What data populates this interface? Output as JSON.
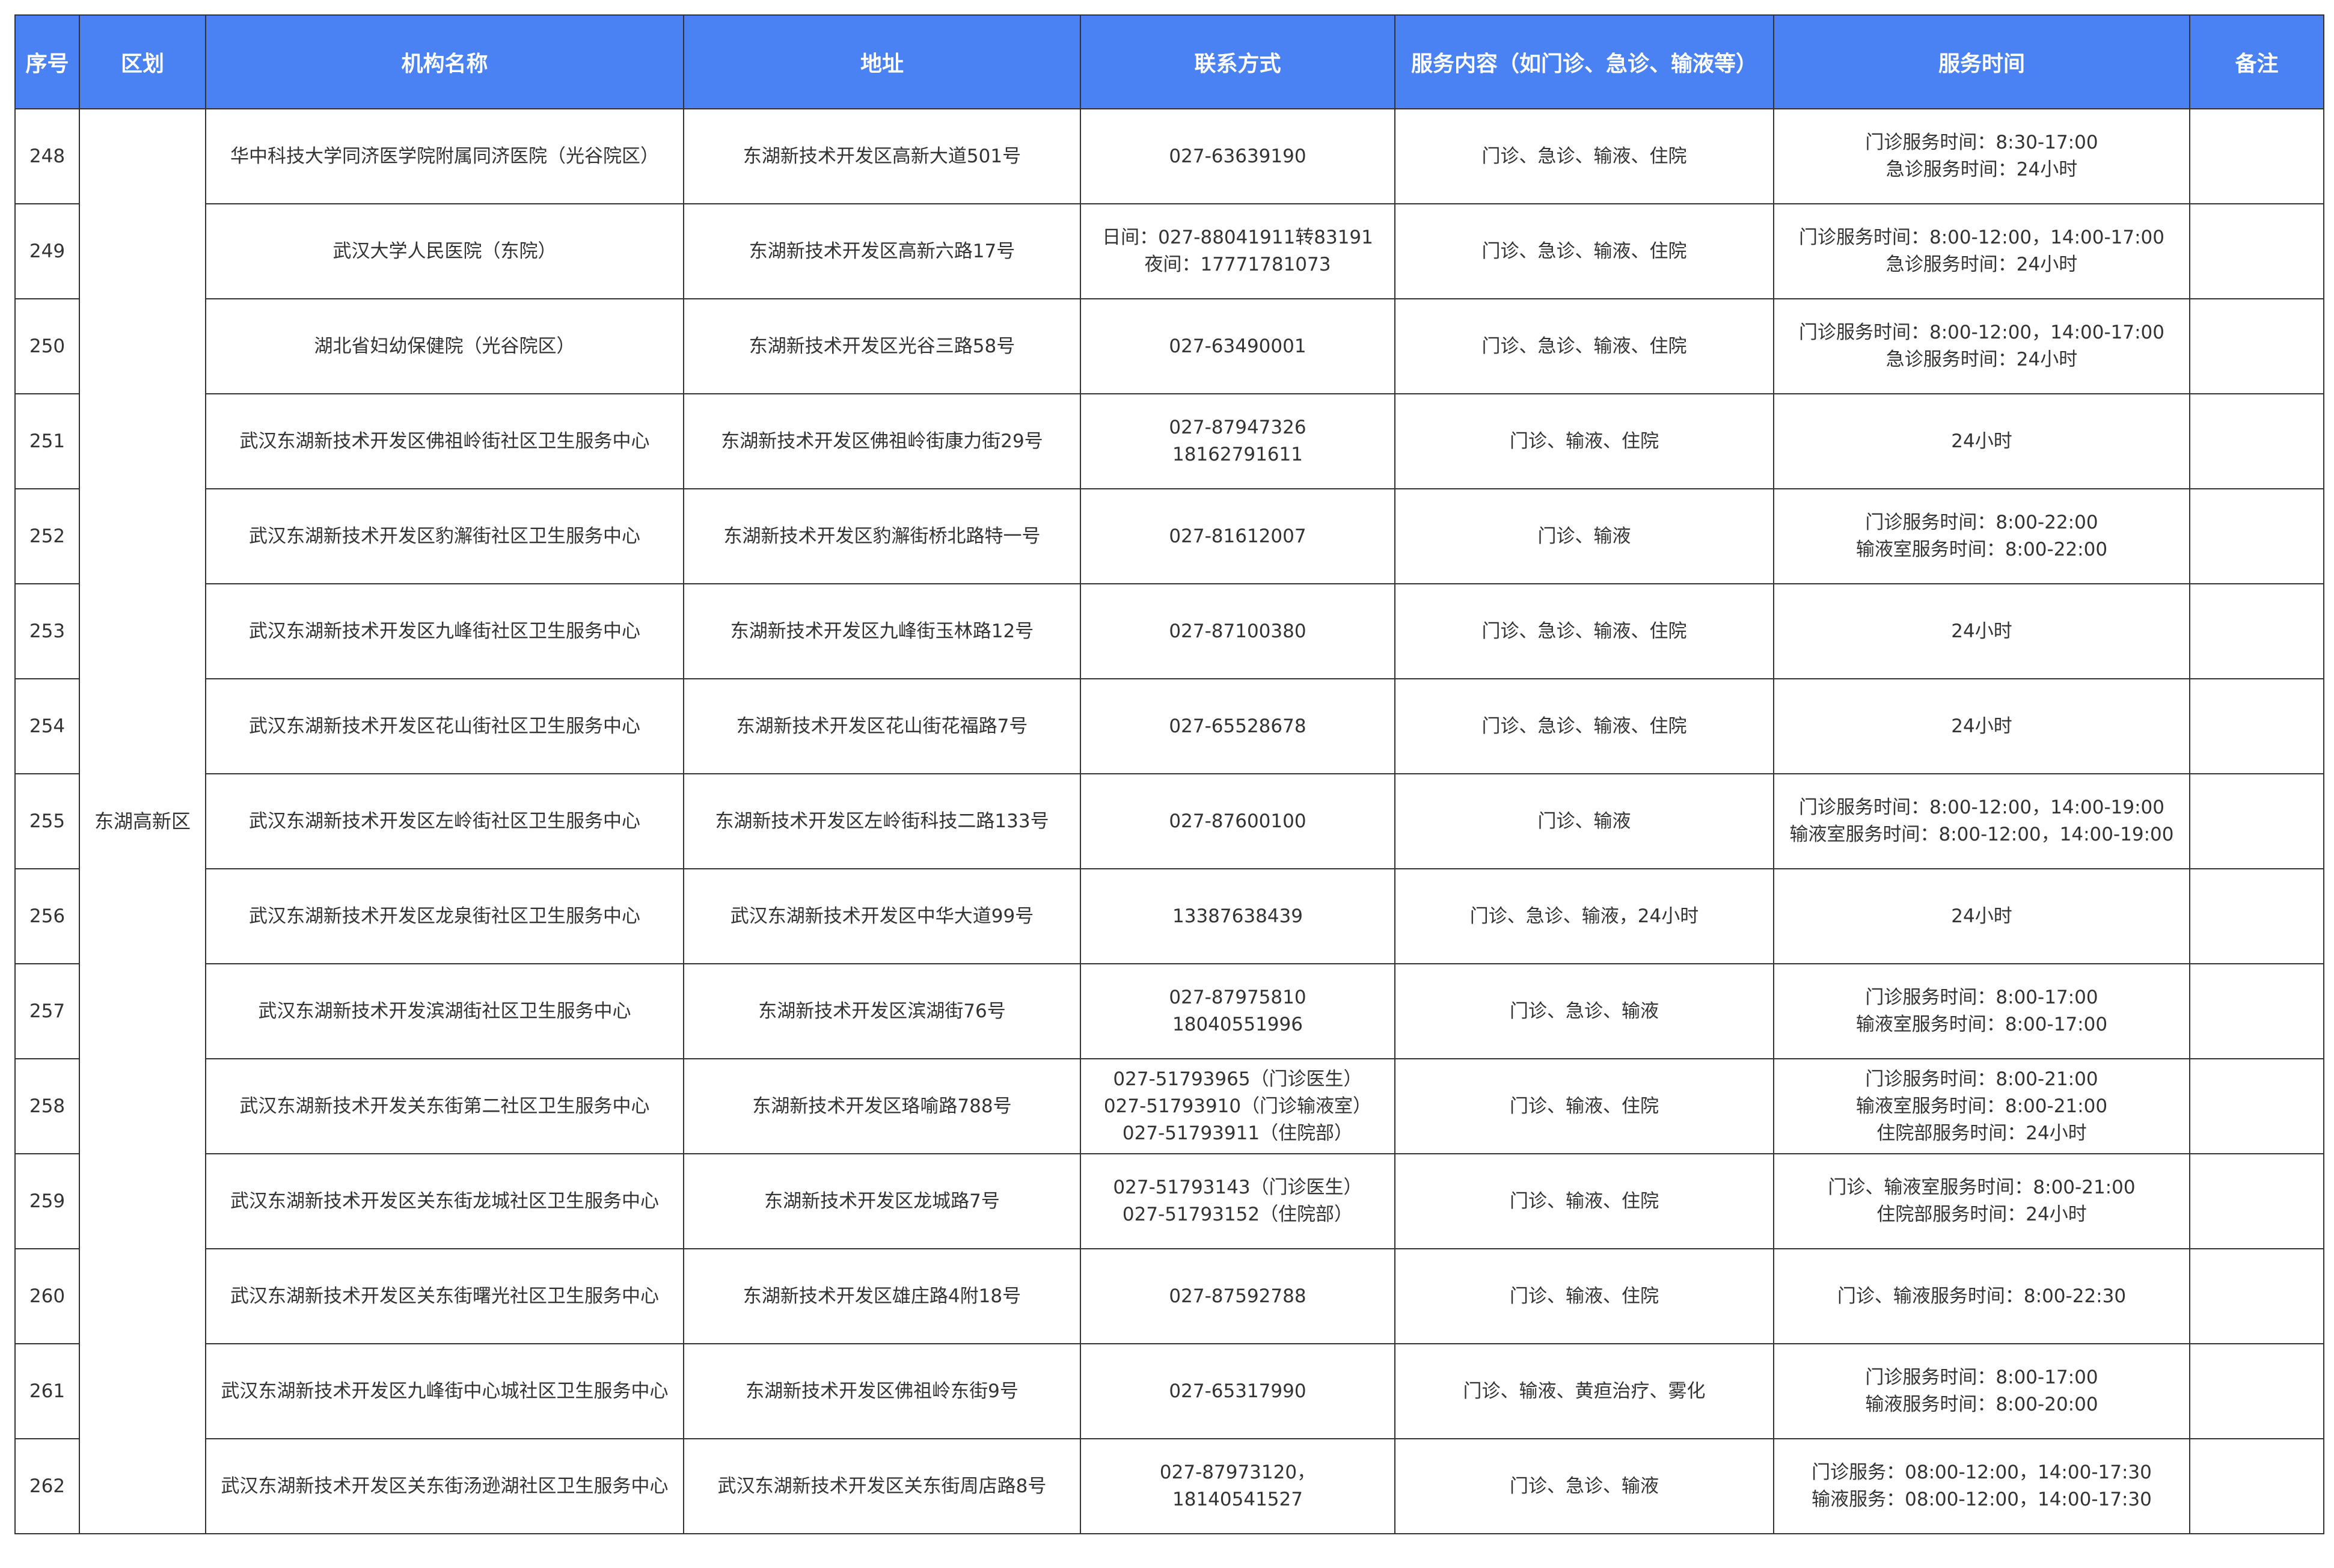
{
  "header": {
    "col_no": "序号",
    "col_district": "区划",
    "col_name": "机构名称",
    "col_address": "地址",
    "col_contact": "联系方式",
    "col_service": "服务内容（如门诊、急诊、输液等）",
    "col_time": "服务时间",
    "col_note": "备注"
  },
  "district": "东湖高新区",
  "rows": [
    {
      "no": "248",
      "name": "华中科技大学同济医学院附属同济医院（光谷院区）",
      "address": "东湖新技术开发区高新大道501号",
      "contact": [
        "027-63639190"
      ],
      "service": "门诊、急诊、输液、住院",
      "time": [
        "门诊服务时间：8:30-17:00",
        "急诊服务时间：24小时"
      ],
      "note": ""
    },
    {
      "no": "249",
      "name": "武汉大学人民医院（东院）",
      "address": "东湖新技术开发区高新六路17号",
      "contact": [
        "日间：027-88041911转83191",
        "夜间：17771781073"
      ],
      "service": "门诊、急诊、输液、住院",
      "time": [
        "门诊服务时间：8:00-12:00，14:00-17:00",
        "急诊服务时间：24小时"
      ],
      "note": ""
    },
    {
      "no": "250",
      "name": "湖北省妇幼保健院（光谷院区）",
      "address": "东湖新技术开发区光谷三路58号",
      "contact": [
        "027-63490001"
      ],
      "service": "门诊、急诊、输液、住院",
      "time": [
        "门诊服务时间：8:00-12:00，14:00-17:00",
        "急诊服务时间：24小时"
      ],
      "note": ""
    },
    {
      "no": "251",
      "name": "武汉东湖新技术开发区佛祖岭街社区卫生服务中心",
      "address": "东湖新技术开发区佛祖岭街康力街29号",
      "contact": [
        "027-87947326",
        "18162791611"
      ],
      "service": "门诊、输液、住院",
      "time": [
        "24小时"
      ],
      "note": ""
    },
    {
      "no": "252",
      "name": "武汉东湖新技术开发区豹澥街社区卫生服务中心",
      "address": "东湖新技术开发区豹澥街桥北路特一号",
      "contact": [
        "027-81612007"
      ],
      "service": "门诊、输液",
      "time": [
        "门诊服务时间：8:00-22:00",
        "输液室服务时间：8:00-22:00"
      ],
      "note": ""
    },
    {
      "no": "253",
      "name": "武汉东湖新技术开发区九峰街社区卫生服务中心",
      "address": "东湖新技术开发区九峰街玉林路12号",
      "contact": [
        "027-87100380"
      ],
      "service": "门诊、急诊、输液、住院",
      "time": [
        "24小时"
      ],
      "note": ""
    },
    {
      "no": "254",
      "name": "武汉东湖新技术开发区花山街社区卫生服务中心",
      "address": "东湖新技术开发区花山街花福路7号",
      "contact": [
        "027-65528678"
      ],
      "service": "门诊、急诊、输液、住院",
      "time": [
        "24小时"
      ],
      "note": ""
    },
    {
      "no": "255",
      "name": "武汉东湖新技术开发区左岭街社区卫生服务中心",
      "address": "东湖新技术开发区左岭街科技二路133号",
      "contact": [
        "027-87600100"
      ],
      "service": "门诊、输液",
      "time": [
        "门诊服务时间：8:00-12:00，14:00-19:00",
        "输液室服务时间：8:00-12:00，14:00-19:00"
      ],
      "note": ""
    },
    {
      "no": "256",
      "name": "武汉东湖新技术开发区龙泉街社区卫生服务中心",
      "address": "武汉东湖新技术开发区中华大道99号",
      "contact": [
        "13387638439"
      ],
      "service": "门诊、急诊、输液，24小时",
      "time": [
        "24小时"
      ],
      "note": ""
    },
    {
      "no": "257",
      "name": "武汉东湖新技术开发滨湖街社区卫生服务中心",
      "address": "东湖新技术开发区滨湖街76号",
      "contact": [
        "027-87975810",
        "18040551996"
      ],
      "service": "门诊、急诊、输液",
      "time": [
        "门诊服务时间：8:00-17:00",
        "输液室服务时间：8:00-17:00"
      ],
      "note": ""
    },
    {
      "no": "258",
      "name": "武汉东湖新技术开发关东街第二社区卫生服务中心",
      "address": "东湖新技术开发区珞喻路788号",
      "contact": [
        "027-51793965（门诊医生）",
        "027-51793910（门诊输液室）",
        "027-51793911（住院部）"
      ],
      "service": "门诊、输液、住院",
      "time": [
        "门诊服务时间：8:00-21:00",
        "输液室服务时间：8:00-21:00",
        "住院部服务时间：24小时"
      ],
      "note": ""
    },
    {
      "no": "259",
      "name": "武汉东湖新技术开发区关东街龙城社区卫生服务中心",
      "address": "东湖新技术开发区龙城路7号",
      "contact": [
        "027-51793143（门诊医生）",
        "027-51793152（住院部）"
      ],
      "service": "门诊、输液、住院",
      "time": [
        "门诊、输液室服务时间：8:00-21:00",
        "住院部服务时间：24小时"
      ],
      "note": ""
    },
    {
      "no": "260",
      "name": "武汉东湖新技术开发区关东街曙光社区卫生服务中心",
      "address": "东湖新技术开发区雄庄路4附18号",
      "contact": [
        "027-87592788"
      ],
      "service": "门诊、输液、住院",
      "time": [
        "门诊、输液服务时间：8:00-22:30"
      ],
      "note": ""
    },
    {
      "no": "261",
      "name": "武汉东湖新技术开发区九峰街中心城社区卫生服务中心",
      "address": "东湖新技术开发区佛祖岭东街9号",
      "contact": [
        "027-65317990"
      ],
      "service": "门诊、输液、黄疸治疗、雾化",
      "time": [
        "门诊服务时间：8:00-17:00",
        "输液服务时间：8:00-20:00"
      ],
      "note": ""
    },
    {
      "no": "262",
      "name": "武汉东湖新技术开发区关东街汤逊湖社区卫生服务中心",
      "address": "武汉东湖新技术开发区关东街周店路8号",
      "contact": [
        "027-87973120，",
        "18140541527"
      ],
      "service": "门诊、急诊、输液",
      "time": [
        "门诊服务：08:00-12:00，14:00-17:30",
        "输液服务：08:00-12:00，14:00-17:30"
      ],
      "note": ""
    }
  ]
}
